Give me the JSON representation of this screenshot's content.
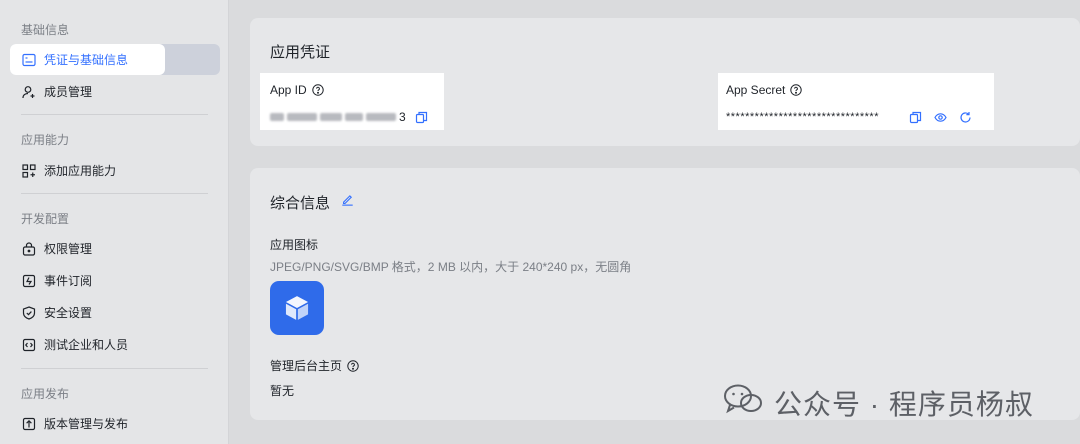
{
  "sidebar": {
    "sections": [
      {
        "title": "基础信息"
      },
      {
        "title": "应用能力"
      },
      {
        "title": "开发配置"
      },
      {
        "title": "应用发布"
      }
    ],
    "items": [
      {
        "label": "凭证与基础信息",
        "icon": "credentials-icon"
      },
      {
        "label": "成员管理",
        "icon": "add-member-icon"
      },
      {
        "label": "添加应用能力",
        "icon": "apps-grid-icon"
      },
      {
        "label": "权限管理",
        "icon": "lock-icon"
      },
      {
        "label": "事件订阅",
        "icon": "event-icon"
      },
      {
        "label": "安全设置",
        "icon": "shield-icon"
      },
      {
        "label": "测试企业和人员",
        "icon": "code-icon"
      },
      {
        "label": "版本管理与发布",
        "icon": "upload-icon"
      }
    ]
  },
  "credentials": {
    "title": "应用凭证",
    "app_id_label": "App ID",
    "app_id_suffix": "3",
    "app_secret_label": "App Secret",
    "app_secret_value": "********************************"
  },
  "general": {
    "title": "综合信息",
    "icon_label": "应用图标",
    "icon_hint": "JPEG/PNG/SVG/BMP 格式，2 MB 以内，大于 240*240 px，无圆角",
    "homepage_label": "管理后台主页",
    "homepage_value": "暂无"
  },
  "watermark": {
    "text": "公众号 · 程序员杨叔"
  },
  "colors": {
    "accent": "#3370ff",
    "app_icon_bg": "#2f6bea"
  }
}
